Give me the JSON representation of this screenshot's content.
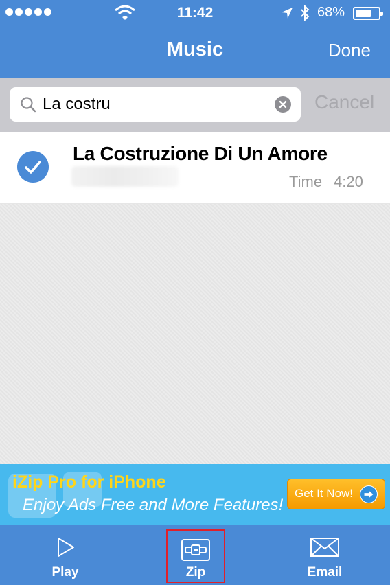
{
  "status_bar": {
    "time": "11:42",
    "battery_percent": "68%",
    "battery_level": 0.68,
    "signal_dots": 5
  },
  "nav": {
    "title": "Music",
    "done_label": "Done"
  },
  "search": {
    "value": "La costru",
    "cancel_label": "Cancel"
  },
  "results": [
    {
      "title": "La Costruzione Di Un Amore",
      "selected": true,
      "time_label": "Time",
      "duration": "4:20"
    }
  ],
  "ad": {
    "title": "iZip Pro for iPhone",
    "subtitle": "Enjoy Ads Free and More Features!",
    "button_label": "Get It Now!"
  },
  "tabs": {
    "play": "Play",
    "zip": "Zip",
    "email": "Email"
  },
  "colors": {
    "bar_blue": "#4a8ad6",
    "ad_blue": "#47b9ee",
    "ad_title_yellow": "#ffd51a",
    "ad_button_orange": "#f59a00",
    "highlight_red": "#e0202a"
  },
  "icons": [
    "signal-dots-icon",
    "wifi-icon",
    "location-arrow-icon",
    "bluetooth-icon",
    "battery-icon",
    "search-icon",
    "clear-icon",
    "checkmark-icon",
    "arrow-right-icon",
    "play-icon",
    "zip-icon",
    "envelope-icon"
  ]
}
